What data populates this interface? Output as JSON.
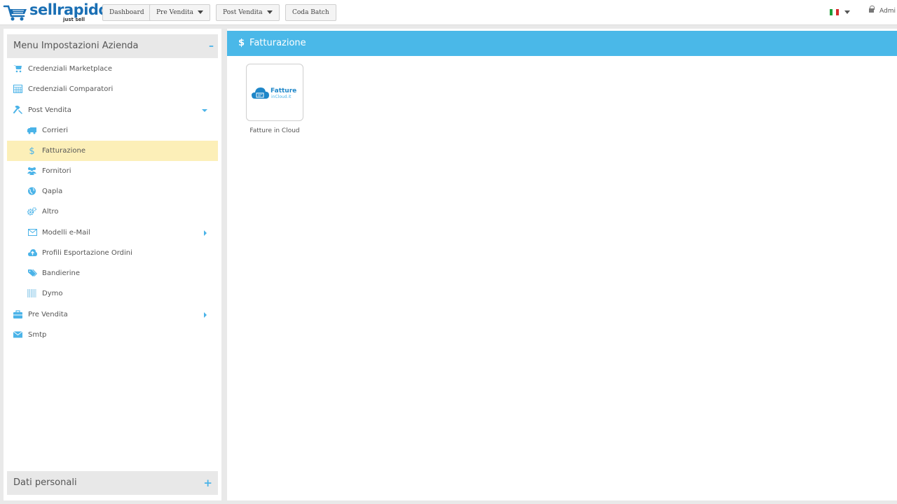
{
  "topbar": {
    "logo_text": "sellrapido",
    "logo_tagline": "just sell",
    "nav": [
      {
        "label": "Dashboard"
      },
      {
        "label": "Pre Vendita"
      },
      {
        "label": "Post Vendita"
      },
      {
        "label": "Coda Batch"
      }
    ],
    "language": "it",
    "user_label": "Admi"
  },
  "sidebar": {
    "header_title": "Menu Impostazioni Azienda",
    "header_toggle": "–",
    "items": [
      {
        "label": "Credenziali Marketplace",
        "icon": "cart-icon"
      },
      {
        "label": "Credenziali Comparatori",
        "icon": "grid-calculator-icon"
      },
      {
        "label": "Post Vendita",
        "icon": "gavel-icon"
      },
      {
        "label": "Corrieri",
        "icon": "truck-icon"
      },
      {
        "label": "Fatturazione",
        "icon": "dollar-icon"
      },
      {
        "label": "Fornitori",
        "icon": "users-icon"
      },
      {
        "label": "Qapla",
        "icon": "globe-icon"
      },
      {
        "label": "Altro",
        "icon": "gears-icon"
      },
      {
        "label": "Modelli e-Mail",
        "icon": "envelope-outline-icon"
      },
      {
        "label": "Profili Esportazione Ordini",
        "icon": "cloud-upload-icon"
      },
      {
        "label": "Bandierine",
        "icon": "tags-icon"
      },
      {
        "label": "Dymo",
        "icon": "barcode-icon"
      },
      {
        "label": "Pre Vendita",
        "icon": "briefcase-icon"
      },
      {
        "label": "Smtp",
        "icon": "envelope-icon"
      }
    ],
    "footer_title": "Dati personali",
    "footer_toggle": "+"
  },
  "main": {
    "title_symbol": "$",
    "title": "Fatturazione",
    "cards": [
      {
        "caption": "Fatture in Cloud",
        "logo_line1": "Fatture",
        "logo_line2": "inCloud.it"
      }
    ]
  },
  "colors": {
    "accent": "#4ab8e8",
    "active_row": "#fcefb8",
    "brand": "#1a6fb4"
  }
}
